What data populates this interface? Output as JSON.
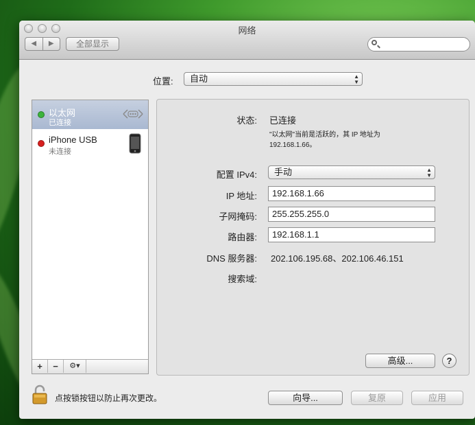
{
  "window": {
    "title": "网络"
  },
  "toolbar": {
    "back": "◀",
    "forward": "▶",
    "show_all": "全部显示",
    "search_placeholder": ""
  },
  "location": {
    "label": "位置:",
    "value": "自动"
  },
  "services": [
    {
      "name": "以太网",
      "status": "已连接",
      "status_color": "#3cb43c"
    },
    {
      "name": "iPhone USB",
      "status": "未连接",
      "status_color": "#d8201f"
    }
  ],
  "sidebar_tools": {
    "add": "+",
    "remove": "−",
    "gear": "⚙▾"
  },
  "detail": {
    "status_label": "状态:",
    "status_value": "已连接",
    "status_desc_1": "\"以太网\"当前是活跃的，其 IP 地址为",
    "status_desc_2": "192.168.1.66。",
    "ipv4_label": "配置 IPv4:",
    "ipv4_value": "手动",
    "ip_label": "IP 地址:",
    "ip_value": "192.168.1.66",
    "mask_label": "子网掩码:",
    "mask_value": "255.255.255.0",
    "router_label": "路由器:",
    "router_value": "192.168.1.1",
    "dns_label": "DNS 服务器:",
    "dns_value": "202.106.195.68、202.106.46.151",
    "search_label": "搜索域:",
    "advanced_label": "高级...",
    "help_label": "?"
  },
  "footer": {
    "lock_text": "点按锁按钮以防止再次更改。",
    "assist_label": "向导...",
    "revert_label": "复原",
    "apply_label": "应用"
  }
}
